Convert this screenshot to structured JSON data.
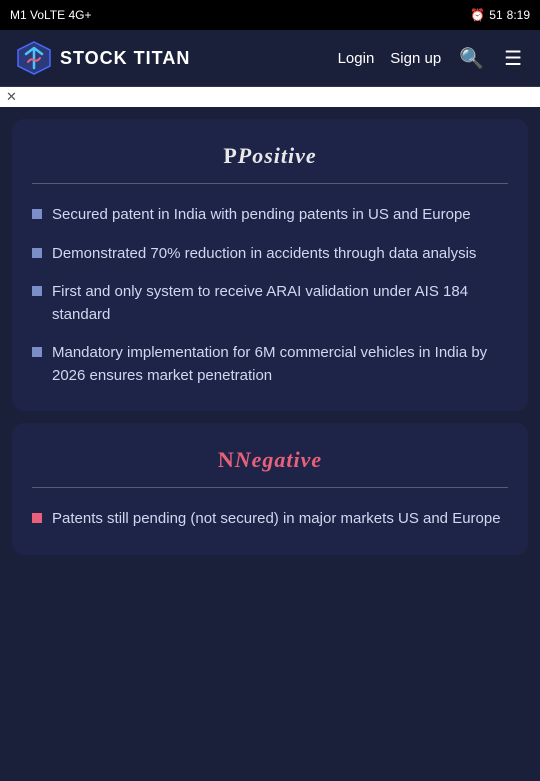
{
  "statusBar": {
    "left": "M1  VoLTE  4G+",
    "alarm": "⏰",
    "battery": "51",
    "time": "8:19"
  },
  "header": {
    "logoText": "STOCK TITAN",
    "loginLabel": "Login",
    "signupLabel": "Sign up",
    "searchIcon": "🔍",
    "menuIcon": "☰"
  },
  "positive": {
    "title": "Positive",
    "items": [
      "Secured patent in India with pending patents in US and Europe",
      "Demonstrated 70% reduction in accidents through data analysis",
      "First and only system to receive ARAI validation under AIS 184 standard",
      "Mandatory implementation for 6M commercial vehicles in India by 2026 ensures market penetration"
    ]
  },
  "negative": {
    "title": "Negative",
    "items": [
      "Patents still pending (not secured) in major markets US and Europe"
    ]
  }
}
